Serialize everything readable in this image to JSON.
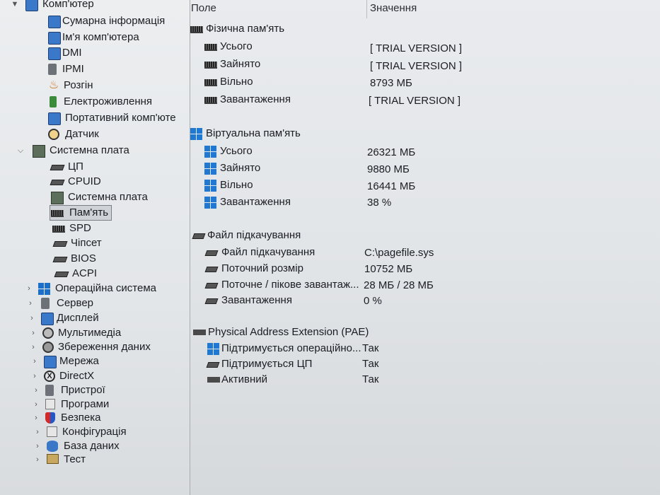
{
  "tree": {
    "root": {
      "label": "Комп'ютер"
    },
    "computer_children": [
      {
        "label": "Сумарна інформація",
        "icon": "monitor-icon"
      },
      {
        "label": "Ім'я комп'ютера",
        "icon": "monitor-icon"
      },
      {
        "label": "DMI",
        "icon": "monitor-icon"
      },
      {
        "label": "IPMI",
        "icon": "server-icon"
      },
      {
        "label": "Розгін",
        "icon": "flame-icon"
      },
      {
        "label": "Електроживлення",
        "icon": "battery-icon"
      },
      {
        "label": "Портативний комп'юте",
        "icon": "laptop-icon"
      },
      {
        "label": "Датчик",
        "icon": "sensor-icon"
      }
    ],
    "motherboard": {
      "label": "Системна плата"
    },
    "motherboard_children": [
      {
        "label": "ЦП",
        "icon": "cpu-icon"
      },
      {
        "label": "CPUID",
        "icon": "cpu-icon"
      },
      {
        "label": "Системна плата",
        "icon": "motherboard-icon"
      },
      {
        "label": "Пам'ять",
        "icon": "ram-icon",
        "selected": true
      },
      {
        "label": "SPD",
        "icon": "ram-icon"
      },
      {
        "label": "Чіпсет",
        "icon": "chip-icon"
      },
      {
        "label": "BIOS",
        "icon": "chip-icon"
      },
      {
        "label": "ACPI",
        "icon": "chip-icon"
      }
    ],
    "top_level": [
      {
        "label": "Операційна система",
        "icon": "windows-icon"
      },
      {
        "label": "Сервер",
        "icon": "server-icon"
      },
      {
        "label": "Дисплей",
        "icon": "display-icon"
      },
      {
        "label": "Мультимедіа",
        "icon": "multimedia-icon"
      },
      {
        "label": "Збереження даних",
        "icon": "storage-icon"
      },
      {
        "label": "Мережа",
        "icon": "network-icon"
      },
      {
        "label": "DirectX",
        "icon": "xbox-icon"
      },
      {
        "label": "Пристрої",
        "icon": "devices-icon"
      },
      {
        "label": "Програми",
        "icon": "programs-icon"
      },
      {
        "label": "Безпека",
        "icon": "shield-icon"
      },
      {
        "label": "Конфігурація",
        "icon": "config-icon"
      },
      {
        "label": "База даних",
        "icon": "database-icon"
      },
      {
        "label": "Тест",
        "icon": "test-icon"
      }
    ]
  },
  "table": {
    "col_field": "Поле",
    "col_value": "Значення",
    "groups": [
      {
        "title": "Фізична пам'ять",
        "icon": "ram-icon",
        "rows": [
          {
            "field": "Усього",
            "value": "[ TRIAL VERSION ]",
            "icon": "ram-icon"
          },
          {
            "field": "Зайнято",
            "value": "[ TRIAL VERSION ]",
            "icon": "ram-icon"
          },
          {
            "field": "Вільно",
            "value": "8793 МБ",
            "icon": "ram-icon"
          },
          {
            "field": "Завантаження",
            "value": "[ TRIAL VERSION ]",
            "icon": "ram-icon"
          }
        ]
      },
      {
        "title": "Віртуальна пам'ять",
        "icon": "windows-icon",
        "rows": [
          {
            "field": "Усього",
            "value": "26321 МБ",
            "icon": "windows-icon"
          },
          {
            "field": "Зайнято",
            "value": "9880 МБ",
            "icon": "windows-icon"
          },
          {
            "field": "Вільно",
            "value": "16441 МБ",
            "icon": "windows-icon"
          },
          {
            "field": "Завантаження",
            "value": "38 %",
            "icon": "windows-icon"
          }
        ]
      },
      {
        "title": "Файл підкачування",
        "icon": "pagefile-icon",
        "rows": [
          {
            "field": "Файл підкачування",
            "value": "C:\\pagefile.sys",
            "icon": "pagefile-icon"
          },
          {
            "field": "Поточний розмір",
            "value": "10752 МБ",
            "icon": "pagefile-icon"
          },
          {
            "field": "Поточне / пікове завантаж...",
            "value": "28 МБ / 28 МБ",
            "icon": "pagefile-icon"
          },
          {
            "field": "Завантаження",
            "value": "0 %",
            "icon": "pagefile-icon"
          }
        ]
      },
      {
        "title": "Physical Address Extension (PAE)",
        "icon": "ram-icon",
        "rows": [
          {
            "field": "Підтримується операційно...",
            "value": "Так",
            "icon": "windows-icon"
          },
          {
            "field": "Підтримується ЦП",
            "value": "Так",
            "icon": "cpu-icon"
          },
          {
            "field": "Активний",
            "value": "Так",
            "icon": "ram-icon"
          }
        ]
      }
    ]
  }
}
